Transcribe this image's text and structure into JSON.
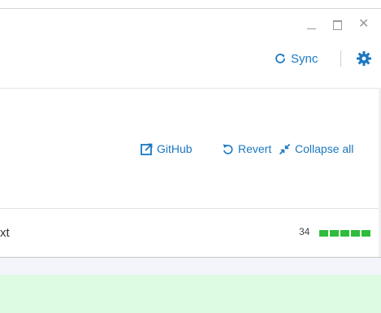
{
  "window_controls": {
    "minimize": "",
    "maximize": "",
    "close": "✕"
  },
  "sync": {
    "label": "Sync"
  },
  "toolbar": {
    "github_label": "GitHub",
    "revert_label": "Revert",
    "collapse_label": "Collapse all"
  },
  "file": {
    "name_fragment": "xt",
    "additions": "34"
  },
  "colors": {
    "accent": "#1a78c2",
    "addition": "#2dbd3a",
    "added_line_bg": "#ddfbe3"
  }
}
